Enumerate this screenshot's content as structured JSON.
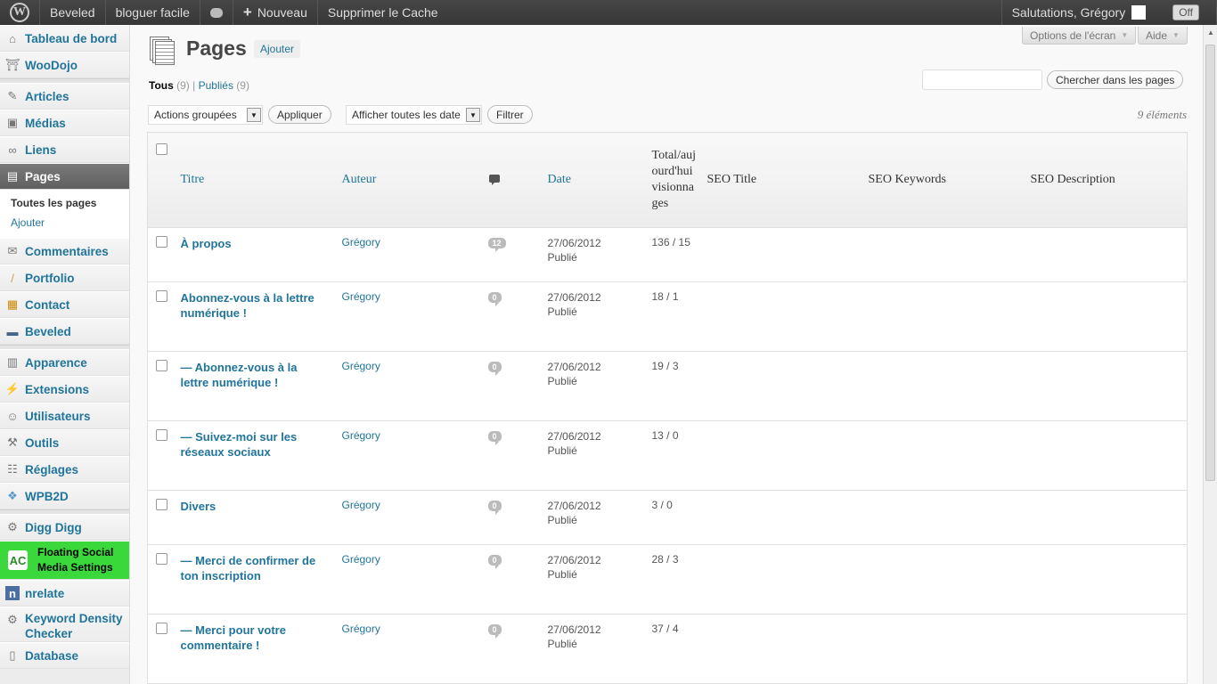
{
  "adminbar": {
    "site_name": "Beveled",
    "site2": "bloguer facile",
    "new_label": "Nouveau",
    "cache_label": "Supprimer le Cache",
    "greeting": "Salutations, Grégory",
    "toggle": "Off"
  },
  "sidebar": {
    "items": [
      {
        "label": "Tableau de bord",
        "icon": "dashboard-icon"
      },
      {
        "label": "WooDojo",
        "icon": "woodojo-icon"
      },
      {
        "label": "Articles",
        "icon": "pin-icon"
      },
      {
        "label": "Médias",
        "icon": "media-icon"
      },
      {
        "label": "Liens",
        "icon": "link-icon"
      },
      {
        "label": "Pages",
        "icon": "pages-icon"
      },
      {
        "label": "Commentaires",
        "icon": "comment-icon"
      },
      {
        "label": "Portfolio",
        "icon": "brush-icon"
      },
      {
        "label": "Contact",
        "icon": "contact-icon"
      },
      {
        "label": "Beveled",
        "icon": "theme-icon"
      },
      {
        "label": "Apparence",
        "icon": "appearance-icon"
      },
      {
        "label": "Extensions",
        "icon": "plugin-icon"
      },
      {
        "label": "Utilisateurs",
        "icon": "users-icon"
      },
      {
        "label": "Outils",
        "icon": "tools-icon"
      },
      {
        "label": "Réglages",
        "icon": "settings-icon"
      },
      {
        "label": "WPB2D",
        "icon": "dropbox-icon"
      },
      {
        "label": "Digg Digg",
        "icon": "gear-icon"
      },
      {
        "label": "Floating Social Media Settings",
        "icon": "afc-icon"
      },
      {
        "label": "nrelate",
        "icon": "nrelate-icon"
      },
      {
        "label": "Keyword Density Checker",
        "icon": "gear-icon"
      },
      {
        "label": "Database",
        "icon": "database-icon"
      }
    ],
    "submenu": [
      "Toutes les pages",
      "Ajouter"
    ]
  },
  "header": {
    "screen_options": "Options de l'écran",
    "help": "Aide",
    "title": "Pages",
    "add_new": "Ajouter"
  },
  "filters": {
    "all_label": "Tous",
    "all_count": "(9)",
    "published_label": "Publiés",
    "published_count": "(9)",
    "search_button": "Chercher dans les pages",
    "bulk_actions": "Actions groupées",
    "apply": "Appliquer",
    "dates": "Afficher toutes les date",
    "filter": "Filtrer",
    "count": "9 éléments"
  },
  "table": {
    "columns": {
      "title": "Titre",
      "author": "Auteur",
      "date": "Date",
      "views": "Total/aujourd'hui visionnages",
      "seo_title": "SEO Title",
      "seo_keywords": "SEO Keywords",
      "seo_description": "SEO Description"
    },
    "rows": [
      {
        "title": "À propos",
        "author": "Grégory",
        "comments": "12",
        "date": "27/06/2012",
        "status": "Publié",
        "views": "136 / 15"
      },
      {
        "title": "Abonnez-vous à la lettre numérique !",
        "author": "Grégory",
        "comments": "0",
        "date": "27/06/2012",
        "status": "Publié",
        "views": "18 / 1"
      },
      {
        "title": "— Abonnez-vous à la lettre numérique !",
        "author": "Grégory",
        "comments": "0",
        "date": "27/06/2012",
        "status": "Publié",
        "views": "19 / 3"
      },
      {
        "title": "— Suivez-moi sur les réseaux sociaux",
        "author": "Grégory",
        "comments": "0",
        "date": "27/06/2012",
        "status": "Publié",
        "views": "13 / 0"
      },
      {
        "title": "Divers",
        "author": "Grégory",
        "comments": "0",
        "date": "27/06/2012",
        "status": "Publié",
        "views": "3 / 0"
      },
      {
        "title": "— Merci de confirmer de ton inscription",
        "author": "Grégory",
        "comments": "0",
        "date": "27/06/2012",
        "status": "Publié",
        "views": "28 / 3"
      },
      {
        "title": "— Merci pour votre commentaire !",
        "author": "Grégory",
        "comments": "0",
        "date": "27/06/2012",
        "status": "Publié",
        "views": "37 / 4"
      }
    ]
  }
}
